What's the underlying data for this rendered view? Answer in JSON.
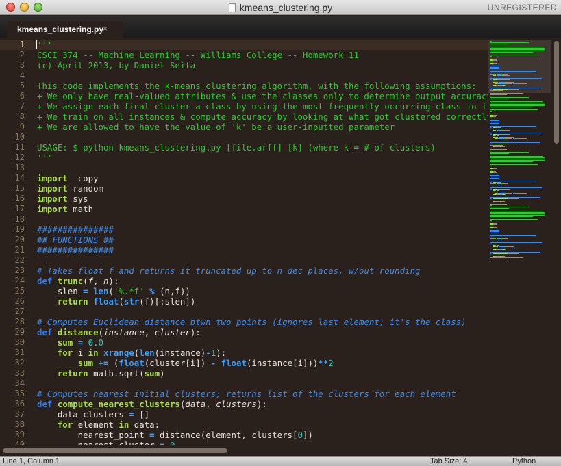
{
  "window": {
    "title": "kmeans_clustering.py",
    "unregistered": "UNREGISTERED"
  },
  "tabs": [
    {
      "label": "kmeans_clustering.py",
      "close": "×"
    }
  ],
  "editor": {
    "current_line": 1,
    "lines": [
      [
        [
          "str",
          "'''"
        ]
      ],
      [
        [
          "str",
          "CSCI 374 -- Machine Learning -- Williams College -- Homework 11"
        ]
      ],
      [
        [
          "str",
          "(c) April 2013, by Daniel Seita"
        ]
      ],
      [],
      [
        [
          "str",
          "This code implements the k-means clustering algorithm, with the following assumptions:"
        ]
      ],
      [
        [
          "str",
          "+ We only have real-valued attributes & use the classes only to determine output accuracy"
        ]
      ],
      [
        [
          "str",
          "+ We assign each final cluster a class by using the most frequently occurring class in it"
        ]
      ],
      [
        [
          "str",
          "+ We train on all instances & compute accuracy by looking at what got clustered correctly"
        ]
      ],
      [
        [
          "str",
          "+ We are allowed to have the value of 'k' be a user-inputted parameter"
        ]
      ],
      [],
      [
        [
          "str",
          "USAGE: $ python kmeans_clustering.py [file.arff] [k] (where k = # of clusters)"
        ]
      ],
      [
        [
          "str",
          "'''"
        ]
      ],
      [],
      [
        [
          "kw",
          "import"
        ],
        [
          "",
          "  copy"
        ]
      ],
      [
        [
          "kw",
          "import"
        ],
        [
          "",
          " random"
        ]
      ],
      [
        [
          "kw",
          "import"
        ],
        [
          "",
          " sys"
        ]
      ],
      [
        [
          "kw",
          "import"
        ],
        [
          "",
          " math"
        ]
      ],
      [],
      [
        [
          "cmt",
          "###############"
        ]
      ],
      [
        [
          "cmt",
          "## FUNCTIONS ##"
        ]
      ],
      [
        [
          "cmt",
          "###############"
        ]
      ],
      [],
      [
        [
          "cmt",
          "# Takes float f and returns it truncated up to n dec places, w/out rounding"
        ]
      ],
      [
        [
          "def",
          "def"
        ],
        [
          "",
          " "
        ],
        [
          "fn",
          "trunc"
        ],
        [
          "",
          "("
        ],
        [
          "par",
          "f"
        ],
        [
          "",
          ", "
        ],
        [
          "par",
          "n"
        ],
        [
          "",
          "):"
        ]
      ],
      [
        [
          "",
          "    slen "
        ],
        [
          "op",
          "="
        ],
        [
          "",
          " "
        ],
        [
          "bi",
          "len"
        ],
        [
          "",
          "("
        ],
        [
          "str",
          "'%.*f'"
        ],
        [
          "",
          " "
        ],
        [
          "op",
          "%"
        ],
        [
          "",
          " (n,f))"
        ]
      ],
      [
        [
          "",
          "    "
        ],
        [
          "kw",
          "return"
        ],
        [
          "",
          " "
        ],
        [
          "bi",
          "float"
        ],
        [
          "",
          "("
        ],
        [
          "bi",
          "str"
        ],
        [
          "",
          "(f)[:slen])"
        ]
      ],
      [],
      [
        [
          "cmt",
          "# Computes Euclidean distance btwn two points (ignores last element; it's the class)"
        ]
      ],
      [
        [
          "def",
          "def"
        ],
        [
          "",
          " "
        ],
        [
          "fn",
          "distance"
        ],
        [
          "",
          "("
        ],
        [
          "par",
          "instance"
        ],
        [
          "",
          ", "
        ],
        [
          "par",
          "cluster"
        ],
        [
          "",
          "):"
        ]
      ],
      [
        [
          "",
          "    "
        ],
        [
          "kw",
          "sum"
        ],
        [
          "",
          " "
        ],
        [
          "op",
          "="
        ],
        [
          "",
          " "
        ],
        [
          "num",
          "0.0"
        ]
      ],
      [
        [
          "",
          "    "
        ],
        [
          "kw",
          "for"
        ],
        [
          "",
          " i "
        ],
        [
          "kw",
          "in"
        ],
        [
          "",
          " "
        ],
        [
          "bi",
          "xrange"
        ],
        [
          "",
          "("
        ],
        [
          "bi",
          "len"
        ],
        [
          "",
          "(instance)"
        ],
        [
          "op",
          "-"
        ],
        [
          "num",
          "1"
        ],
        [
          "",
          "):"
        ]
      ],
      [
        [
          "",
          "        "
        ],
        [
          "kw",
          "sum"
        ],
        [
          "",
          " "
        ],
        [
          "op",
          "+="
        ],
        [
          "",
          " ("
        ],
        [
          "bi",
          "float"
        ],
        [
          "",
          "(cluster[i]) "
        ],
        [
          "op",
          "-"
        ],
        [
          "",
          " "
        ],
        [
          "bi",
          "float"
        ],
        [
          "",
          "(instance[i]))"
        ],
        [
          "op",
          "**"
        ],
        [
          "num",
          "2"
        ]
      ],
      [
        [
          "",
          "    "
        ],
        [
          "kw",
          "return"
        ],
        [
          "",
          " math.sqrt("
        ],
        [
          "kw",
          "sum"
        ],
        [
          "",
          ")"
        ]
      ],
      [],
      [
        [
          "cmt",
          "# Computes nearest initial clusters; returns list of the clusters for each element"
        ]
      ],
      [
        [
          "def",
          "def"
        ],
        [
          "",
          " "
        ],
        [
          "fn",
          "compute_nearest_clusters"
        ],
        [
          "",
          "("
        ],
        [
          "par",
          "data"
        ],
        [
          "",
          ", "
        ],
        [
          "par",
          "clusters"
        ],
        [
          "",
          "):"
        ]
      ],
      [
        [
          "",
          "    data_clusters "
        ],
        [
          "op",
          "="
        ],
        [
          "",
          " []"
        ]
      ],
      [
        [
          "",
          "    "
        ],
        [
          "kw",
          "for"
        ],
        [
          "",
          " element "
        ],
        [
          "kw",
          "in"
        ],
        [
          "",
          " data:"
        ]
      ],
      [
        [
          "",
          "        nearest_point "
        ],
        [
          "op",
          "="
        ],
        [
          "",
          " distance(element, clusters["
        ],
        [
          "num",
          "0"
        ],
        [
          "",
          "])"
        ]
      ],
      [
        [
          "",
          "        nearest_cluster "
        ],
        [
          "op",
          "="
        ],
        [
          "",
          " "
        ],
        [
          "num",
          "0"
        ]
      ]
    ]
  },
  "status": {
    "position": "Line 1, Column 1",
    "tab_size": "Tab Size: 4",
    "syntax": "Python"
  },
  "colors": {
    "string": "#2ecc2e",
    "keyword": "#a8e043",
    "comment": "#3a8cf0",
    "background": "#2b211c"
  }
}
